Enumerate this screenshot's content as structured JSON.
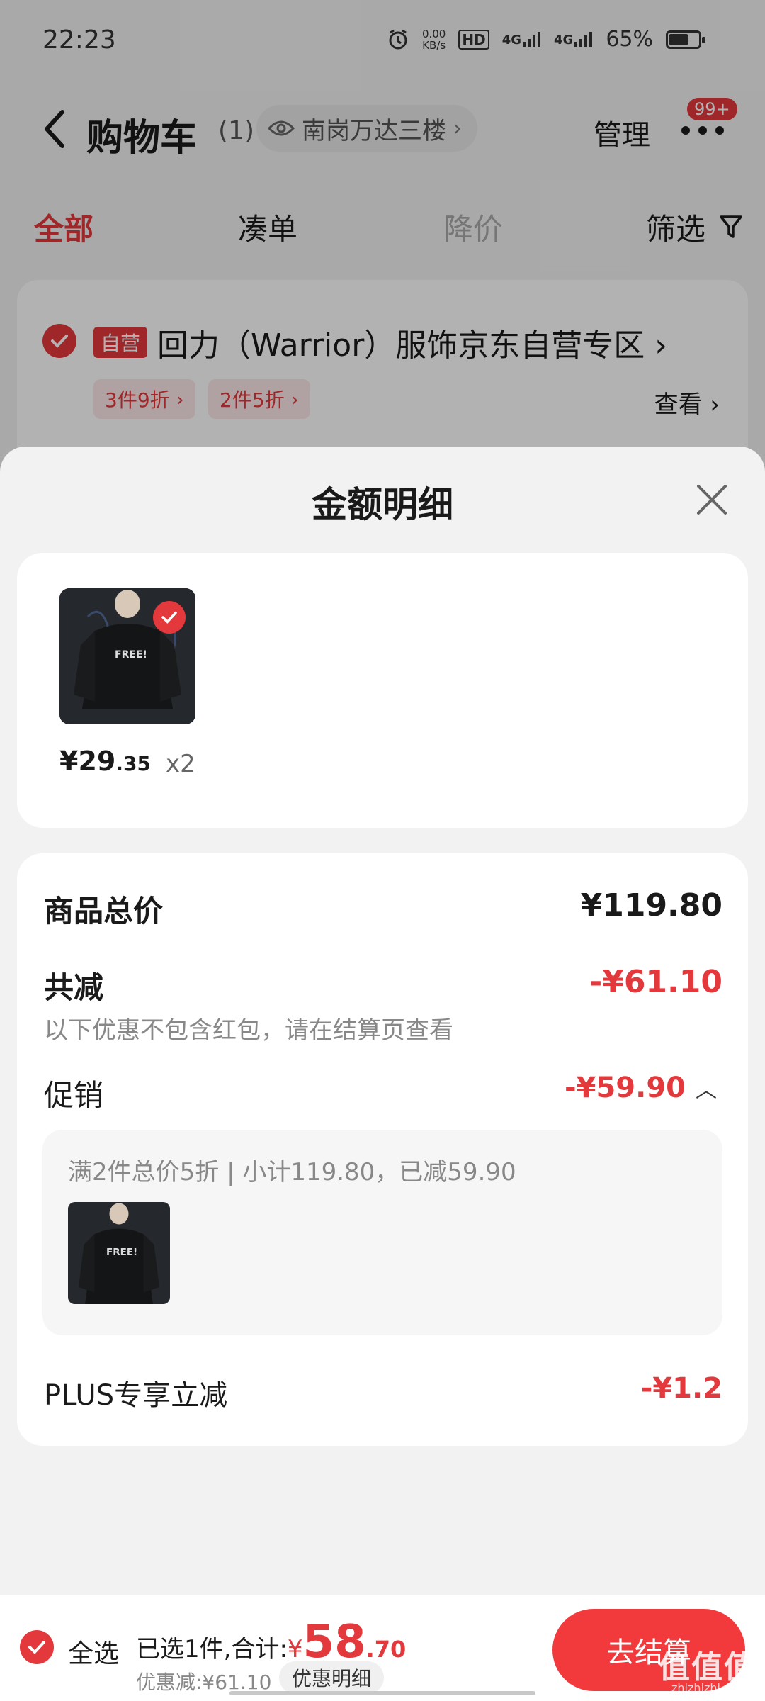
{
  "status_bar": {
    "time": "22:23",
    "net_speed_value": "0.00",
    "net_speed_unit": "KB/s",
    "hd": "HD",
    "net1": "4G",
    "net2": "4G",
    "battery": "65%",
    "battery_level": 0.65
  },
  "header": {
    "title": "购物车",
    "count": "(1)",
    "location": "南岗万达三楼",
    "manage": "管理",
    "badge": "99+"
  },
  "tabs": [
    {
      "label": "全部"
    },
    {
      "label": "凑单"
    },
    {
      "label": "降价"
    },
    {
      "label": "筛选"
    }
  ],
  "shop": {
    "tag": "自营",
    "name": "回力（Warrior）服饰京东自营专区",
    "promos": [
      "3件9折",
      "2件5折"
    ],
    "view": "查看"
  },
  "sheet": {
    "title": "金额明细",
    "item": {
      "print_text": "FREE!",
      "price_symbol": "¥",
      "price_int": "29",
      "price_dec": ".35",
      "qty": "x2"
    },
    "total_label": "商品总价",
    "total_value": "¥119.80",
    "reduce_label": "共减",
    "reduce_value": "-¥61.10",
    "reduce_note": "以下优惠不包含红包，请在结算页查看",
    "promo_label": "促销",
    "promo_value": "-¥59.90",
    "promo_desc": "满2件总价5折 | 小计119.80，已减59.90",
    "plus_label": "PLUS专享立减",
    "plus_value": "-¥1.2"
  },
  "bottom_bar": {
    "select_all": "全选",
    "summary_prefix": "已选1件,合计:",
    "yen": "¥",
    "amount_int": "58",
    "amount_dec": ".70",
    "discount": "优惠减:¥61.10",
    "detail_button": "优惠明细",
    "checkout": "去结算"
  },
  "watermark": {
    "main": "值值值",
    "sub": "zhizhizhi.com"
  },
  "colors": {
    "accent": "#e4393c",
    "checkout": "#f23a3c",
    "card": "#ffffff",
    "sheet_bg": "#f2f2f2"
  }
}
